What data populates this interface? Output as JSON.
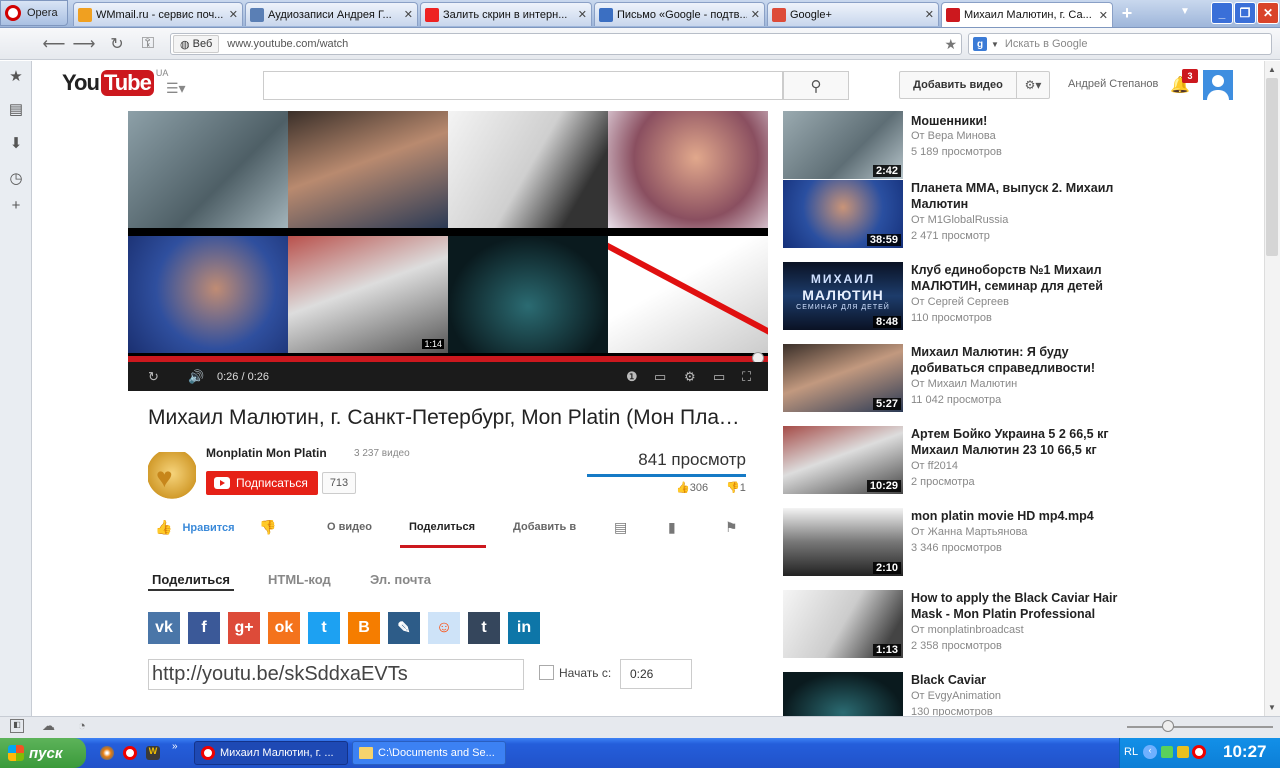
{
  "browser": {
    "menu_label": "Opera",
    "tabs": [
      {
        "label": "WMmail.ru - сервис поч...",
        "icon": "wmmail-icon",
        "color": "#f0a020"
      },
      {
        "label": "Аудиозаписи Андрея Г...",
        "icon": "vk-audio-icon",
        "color": "#5a7fb5"
      },
      {
        "label": "Залить скрин в интерн...",
        "icon": "yandex-icon",
        "color": "#e22"
      },
      {
        "label": "Письмо «Google - подтв...",
        "icon": "mail-icon",
        "color": "#3b6fc2"
      },
      {
        "label": "Google+",
        "icon": "google-plus-icon",
        "color": "#dd4b39"
      },
      {
        "label": "Михаил Малютин, г. Са...",
        "icon": "youtube-icon",
        "color": "#cc181e"
      }
    ],
    "address": {
      "badge": "Веб",
      "url": "www.youtube.com/watch"
    },
    "search": {
      "engine": "g",
      "placeholder": "Искать в Google"
    }
  },
  "youtube": {
    "logo_you": "You",
    "logo_tube": "Tube",
    "logo_region": "UA",
    "upload_label": "Добавить видео",
    "username": "Андрей Степанов",
    "notifications": "3"
  },
  "player": {
    "time": "0:26 / 0:26",
    "thumb_durations": [
      "1:14"
    ]
  },
  "video": {
    "title": "Михаил Малютин, г. Санкт-Петербург, Mon Platin (Мон Платин)",
    "channel": "Monplatin Mon Platin",
    "video_count": "3 237 видео",
    "subscribe_label": "Подписаться",
    "subscribers": "713",
    "views": "841 просмотр",
    "likes": "306",
    "dislikes": "1",
    "like_label": "Нравится",
    "tabs": {
      "about": "О видео",
      "share": "Поделиться",
      "add": "Добавить в"
    },
    "share_tabs": {
      "share": "Поделиться",
      "embed": "HTML-код",
      "email": "Эл. почта"
    },
    "share_link": "http://youtu.be/skSddxaEVTs",
    "start_label": "Начать с:",
    "start_time": "0:26"
  },
  "social": [
    {
      "name": "vk-icon",
      "glyph": "vk",
      "color": "#4a76a8"
    },
    {
      "name": "facebook-icon",
      "glyph": "f",
      "color": "#3b5998"
    },
    {
      "name": "google-plus-icon",
      "glyph": "g+",
      "color": "#dd4b39"
    },
    {
      "name": "odnoklassniki-icon",
      "glyph": "ok",
      "color": "#f4731c"
    },
    {
      "name": "twitter-icon",
      "glyph": "t",
      "color": "#1da1f2"
    },
    {
      "name": "blogger-icon",
      "glyph": "B",
      "color": "#f57d00"
    },
    {
      "name": "livejournal-icon",
      "glyph": "✎",
      "color": "#2d5c88"
    },
    {
      "name": "reddit-icon",
      "glyph": "☺",
      "color": "#cee3f8"
    },
    {
      "name": "tumblr-icon",
      "glyph": "t",
      "color": "#35465c"
    },
    {
      "name": "linkedin-icon",
      "glyph": "in",
      "color": "#0e76a8"
    }
  ],
  "related": [
    {
      "title": "Мошенники!",
      "by": "От Вера Минова",
      "views": "5 189 просмотров",
      "duration": "2:42"
    },
    {
      "title": "Планета ММА, выпуск 2. Михаил Малютин",
      "by": "От M1GlobalRussia",
      "views": "2 471 просмотр",
      "duration": "38:59"
    },
    {
      "title": "Клуб единоборств №1 Михаил МАЛЮТИН, семинар для детей",
      "by": "От Сергей Сергеев",
      "views": "110 просмотров",
      "duration": "8:48"
    },
    {
      "title": "Михаил Малютин: Я буду добиваться справедливости!",
      "by": "От Михаил Малютин",
      "views": "11 042 просмотра",
      "duration": "5:27"
    },
    {
      "title": "Артем Бойко Украина 5 2 66,5 кг Михаил Малютин 23 10 66,5 кг",
      "by": "От ff2014",
      "views": "2 просмотра",
      "duration": "10:29"
    },
    {
      "title": "mon platin movie HD mp4.mp4",
      "by": "От Жанна Мартьянова",
      "views": "3 346 просмотров",
      "duration": "2:10"
    },
    {
      "title": "How to apply the Black Caviar Hair Mask - Mon Platin Professional",
      "by": "От monplatinbroadcast",
      "views": "2 358 просмотров",
      "duration": "1:13"
    },
    {
      "title": "Black Caviar",
      "by": "От EvgyAnimation",
      "views": "130 просмотров",
      "duration": ""
    }
  ],
  "related_thumb_text": {
    "klub_line1": "МИХАИЛ",
    "klub_line2": "МАЛЮТИН",
    "klub_line3": "СЕМИНАР ДЛЯ ДЕТЕЙ"
  },
  "taskbar": {
    "start_label": "пуск",
    "items": [
      "Михаил Малютин, г. ...",
      "C:\\Documents and Se..."
    ],
    "lang": "RL",
    "clock": "10:27"
  }
}
